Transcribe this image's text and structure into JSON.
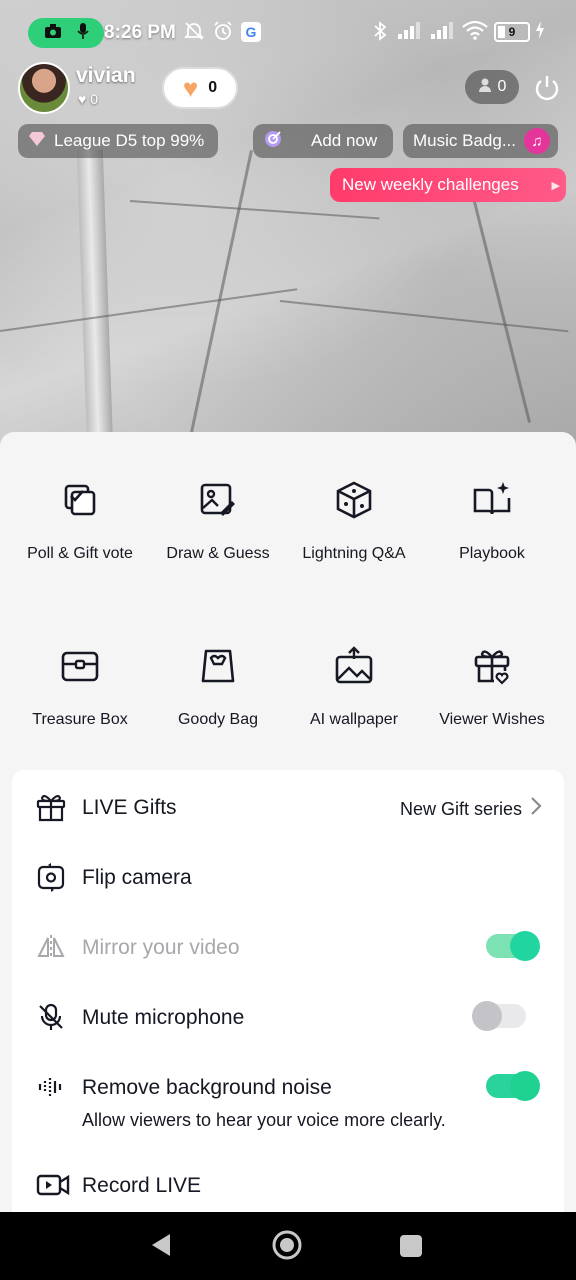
{
  "status_bar": {
    "time": "8:26 PM",
    "battery": "9",
    "icons": [
      "camera-icon",
      "mic-icon",
      "mute-notifications-icon",
      "alarm-icon",
      "google-icon",
      "bluetooth-icon",
      "signal-icon",
      "signal-icon",
      "wifi-icon",
      "battery-icon",
      "charging-icon"
    ]
  },
  "streamer": {
    "name": "vivian",
    "likes": "0",
    "hearts": "0",
    "viewers": "0"
  },
  "chips": {
    "league": "League D5 top 99%",
    "add_now": "Add now",
    "music_badge": "Music Badg...",
    "challenges": "New weekly challenges"
  },
  "tools": [
    {
      "label": "Poll & Gift vote",
      "icon": "poll-icon"
    },
    {
      "label": "Draw & Guess",
      "icon": "draw-guess-icon"
    },
    {
      "label": "Lightning Q&A",
      "icon": "cube-icon"
    },
    {
      "label": "Playbook",
      "icon": "playbook-icon"
    },
    {
      "label": "Treasure Box",
      "icon": "treasure-box-icon"
    },
    {
      "label": "Goody Bag",
      "icon": "goody-bag-icon"
    },
    {
      "label": "AI wallpaper",
      "icon": "ai-wallpaper-icon"
    },
    {
      "label": "Viewer Wishes",
      "icon": "viewer-wishes-icon"
    }
  ],
  "settings": {
    "live_gifts": {
      "label": "LIVE Gifts",
      "value": "New Gift series"
    },
    "flip_camera": {
      "label": "Flip camera"
    },
    "mirror": {
      "label": "Mirror your video",
      "on": true,
      "enabled": false
    },
    "mute": {
      "label": "Mute microphone",
      "on": false
    },
    "noise": {
      "label": "Remove background noise",
      "sub": "Allow viewers to hear your voice more clearly.",
      "on": true
    },
    "record": {
      "label": "Record LIVE"
    }
  },
  "colors": {
    "toggle_on": "#1fd292",
    "challenge": "#ff3b6b",
    "rec_pill": "#2fcf7a"
  }
}
